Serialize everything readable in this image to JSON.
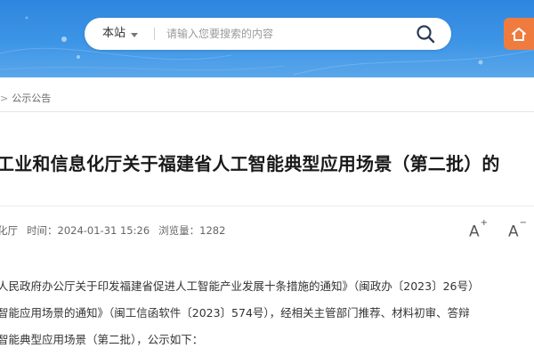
{
  "header": {
    "search": {
      "scope_label": "本站",
      "placeholder": "请输入您要搜索的内容"
    },
    "icons": {
      "search": "search-icon",
      "orange_button": "orange-action-icon"
    },
    "colors": {
      "header_blue": "#3d95e6",
      "orange_button": "#f07b3f"
    }
  },
  "breadcrumb": {
    "separator": ">",
    "current": "公示公告"
  },
  "article": {
    "title": "工业和信息化厅关于福建省人工智能典型应用场景（第二批）的",
    "meta": {
      "source": "化厅",
      "time_label": "时间：",
      "time_value": "2024-01-31 15:26",
      "views_label": "浏览量：",
      "views_value": "1282"
    },
    "font_controls": {
      "increase_label": "A",
      "increase_symbol": "+",
      "decrease_label": "A",
      "decrease_symbol": "−"
    },
    "body": [
      "人民政府办公厅关于印发福建省促进人工智能产业发展十条措施的通知》（闽政办〔2023〕26号）",
      "智能应用场景的通知》（闽工信函软件〔2023〕574号），经相关主管部门推荐、材料初审、答辩",
      "智能典型应用场景（第二批），公示如下："
    ]
  }
}
